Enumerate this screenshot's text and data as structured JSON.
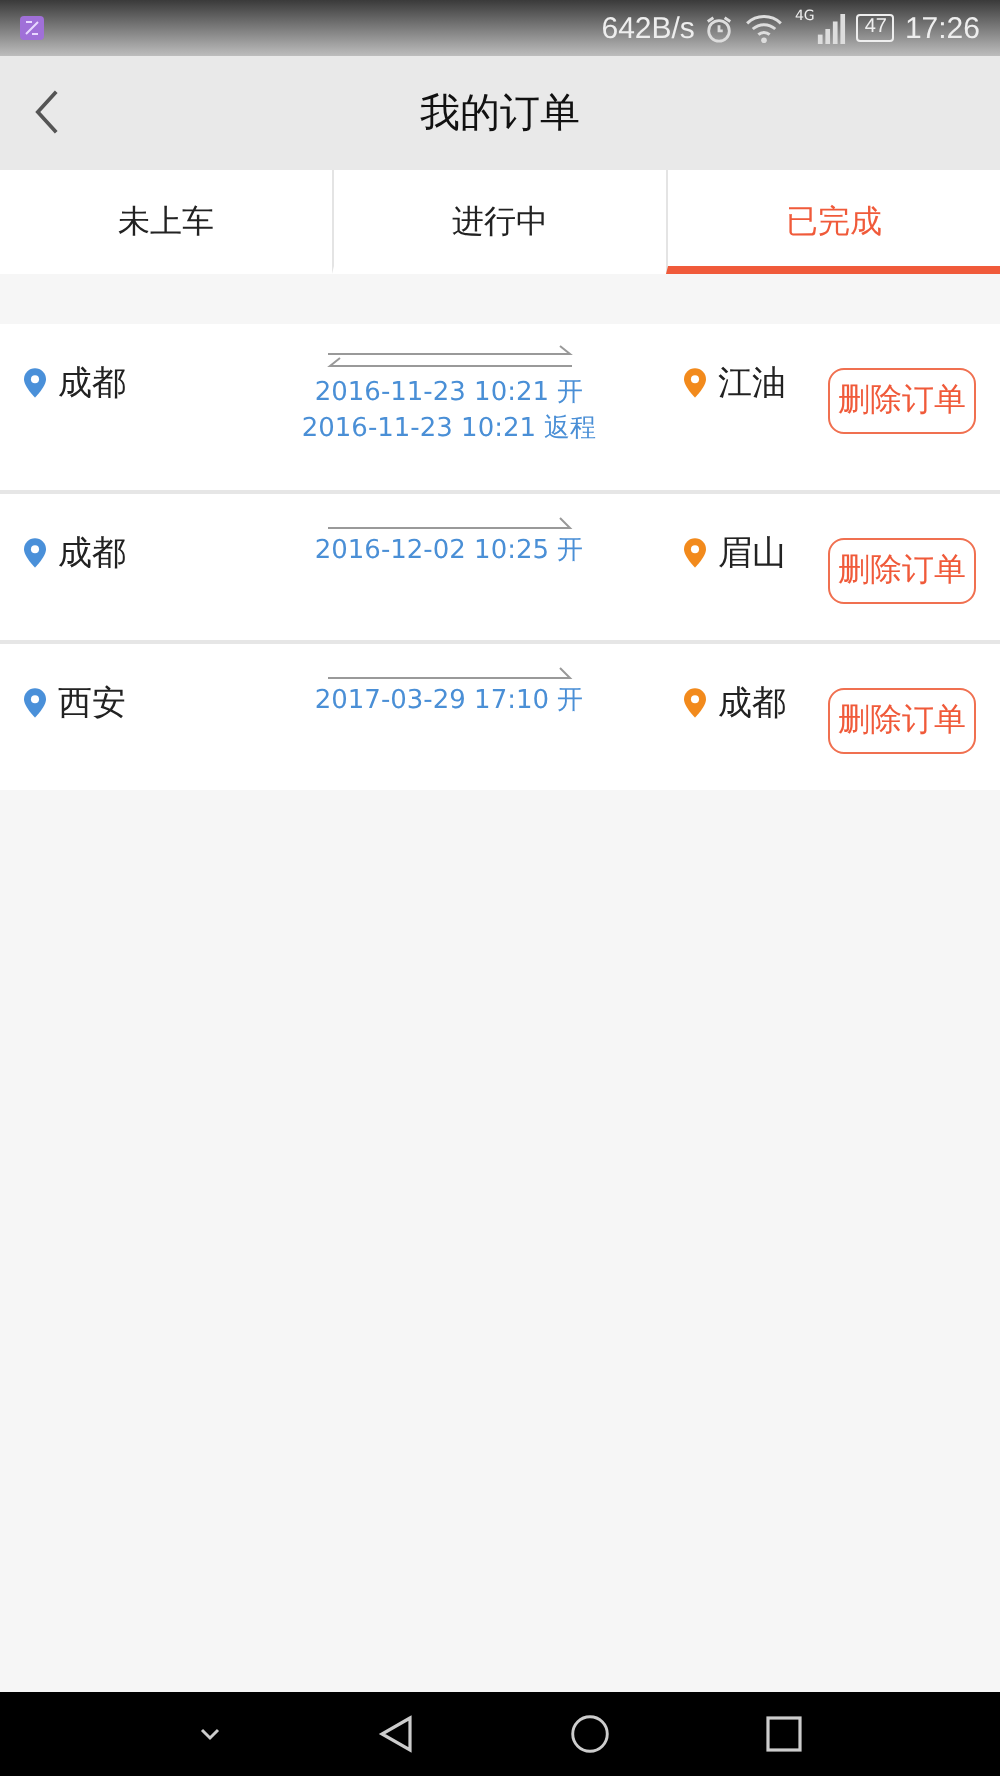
{
  "status_bar": {
    "speed": "642B/s",
    "network": "4G",
    "battery": "47",
    "time": "17:26"
  },
  "header": {
    "title": "我的订单"
  },
  "tabs": [
    {
      "label": "未上车",
      "selected": false
    },
    {
      "label": "进行中",
      "selected": false
    },
    {
      "label": "已完成",
      "selected": true
    }
  ],
  "orders": [
    {
      "from": "成都",
      "to": "江油",
      "round_trip": true,
      "times": [
        "2016-11-23 10:21 开",
        "2016-11-23 10:21 返程"
      ],
      "action": "删除订单"
    },
    {
      "from": "成都",
      "to": "眉山",
      "round_trip": false,
      "times": [
        "2016-12-02 10:25 开"
      ],
      "action": "删除订单"
    },
    {
      "from": "西安",
      "to": "成都",
      "round_trip": false,
      "times": [
        "2017-03-29 17:10 开"
      ],
      "action": "删除订单"
    }
  ]
}
